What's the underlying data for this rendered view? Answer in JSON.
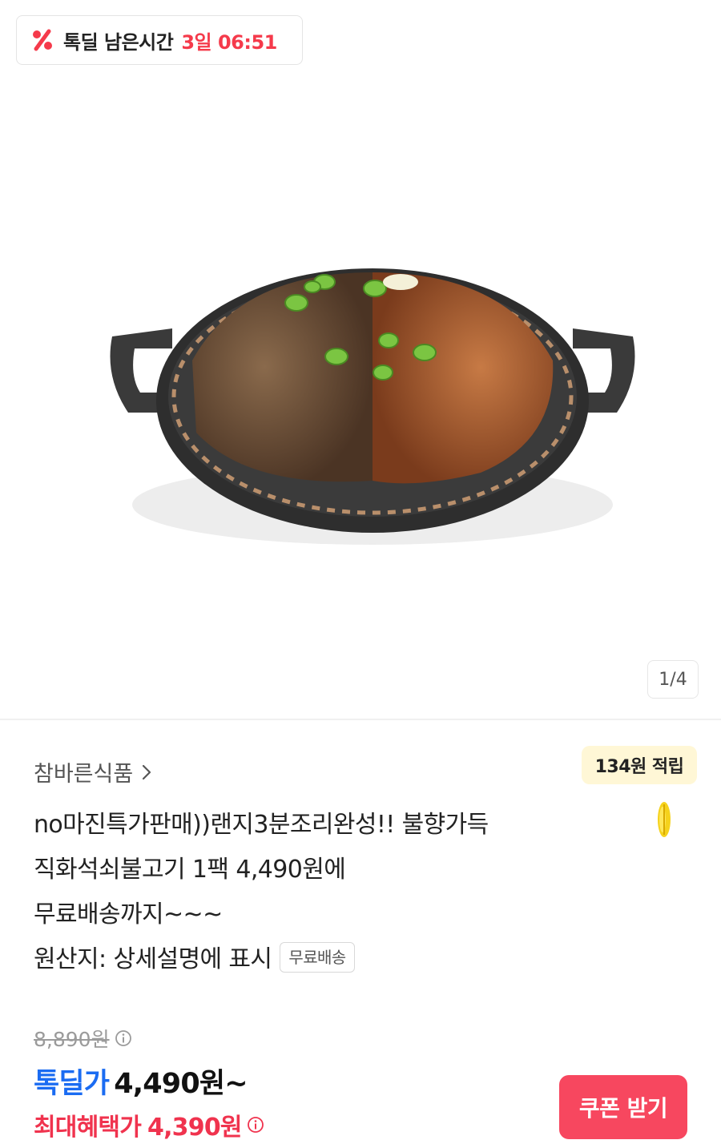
{
  "deal_timer": {
    "label": "톡딜 남은시간",
    "time": "3일 06:51"
  },
  "gallery": {
    "pager": "1/4"
  },
  "store": {
    "name": "참바른식품"
  },
  "reward": {
    "label": "134원 적립"
  },
  "product": {
    "title_lines": [
      "no마진특가판매))랜지3분조리완성!! 불향가득",
      "직화석쇠불고기 1팩 4,490원에",
      "무료배송까지~~~",
      "원산지: 상세설명에 표시"
    ],
    "badge": "무료배송"
  },
  "price": {
    "original": "8,890원",
    "deal_label": "톡딜가",
    "deal_value": "4,490원~",
    "best_label": "최대혜택가",
    "best_value": "4,390원"
  },
  "actions": {
    "coupon": "쿠폰 받기"
  },
  "colors": {
    "accent_red": "#f53a4b",
    "deal_blue": "#1b6cf2",
    "button_red": "#f7475f"
  }
}
